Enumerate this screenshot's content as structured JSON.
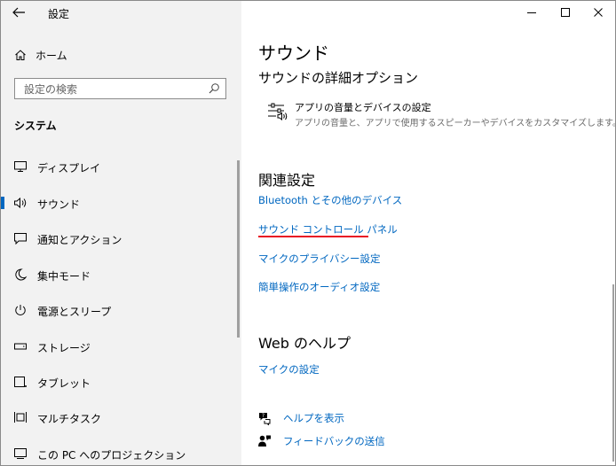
{
  "app_title": "設定",
  "home": {
    "label": "ホーム",
    "icon": "home-icon"
  },
  "search": {
    "placeholder": "設定の検索"
  },
  "section": "システム",
  "nav": [
    {
      "label": "ディスプレイ",
      "icon": "display-icon"
    },
    {
      "label": "サウンド",
      "icon": "speaker-icon",
      "active": true
    },
    {
      "label": "通知とアクション",
      "icon": "notification-icon"
    },
    {
      "label": "集中モード",
      "icon": "moon-icon"
    },
    {
      "label": "電源とスリープ",
      "icon": "power-icon"
    },
    {
      "label": "ストレージ",
      "icon": "storage-icon"
    },
    {
      "label": "タブレット",
      "icon": "tablet-icon"
    },
    {
      "label": "マルチタスク",
      "icon": "multitask-icon"
    },
    {
      "label": "この PC へのプロジェクション",
      "icon": "projection-icon"
    }
  ],
  "main": {
    "title": "サウンド",
    "subtitle": "サウンドの詳細オプション",
    "app_volume": {
      "title": "アプリの音量とデバイスの設定",
      "description": "アプリの音量と、アプリで使用するスピーカーやデバイスをカスタマイズします。"
    },
    "related_heading": "関連設定",
    "related_links": [
      "Bluetooth とその他のデバイス",
      "サウンド コントロール パネル",
      "マイクのプライバシー設定",
      "簡単操作のオーディオ設定"
    ],
    "web_help_heading": "Web のヘルプ",
    "web_help_links": [
      "マイクの設定"
    ],
    "help_link": "ヘルプを表示",
    "feedback_link": "フィードバックの送信"
  },
  "colors": {
    "accent": "#0067c0",
    "highlight_underline": "#e81123",
    "sidebar_bg": "#f2f2f2"
  }
}
